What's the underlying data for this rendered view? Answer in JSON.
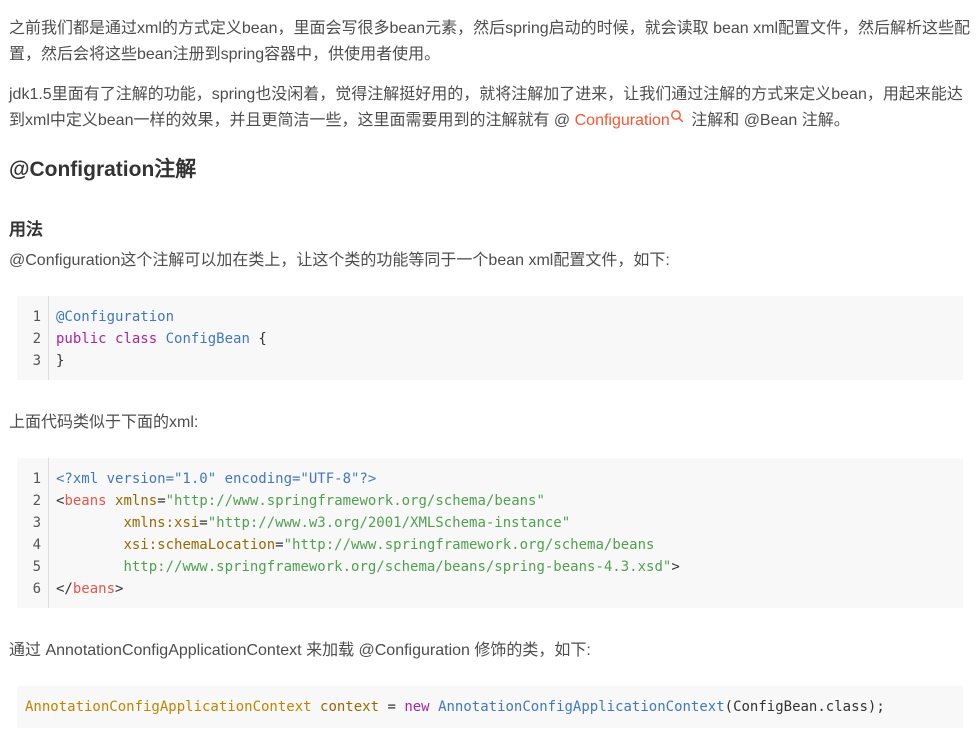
{
  "intro": {
    "p1": "之前我们都是通过xml的方式定义bean，里面会写很多bean元素，然后spring启动的时候，就会读取 bean xml配置文件，然后解析这些配置，然后会将这些bean注册到spring容器中，供使用者使用。",
    "p2_before": "jdk1.5里面有了注解的功能，spring也没闲着，觉得注解挺好用的，就将注解加了进来，让我们通过注解的方式来定义bean，用起来能达到xml中定义bean一样的效果，并且更简洁一些，这里面需要用到的注解就有 @ ",
    "p2_link": "Configuration",
    "p2_after": " 注解和 @Bean 注解。"
  },
  "section": {
    "title": "@Configration注解",
    "subtitle": "用法",
    "desc": "@Configuration这个注解可以加在类上，让这个类的功能等同于一个bean xml配置文件，如下:",
    "xml_intro": "上面代码类似于下面的xml:",
    "ctx_intro": "通过 AnnotationConfigApplicationContext 来加载 @Configuration 修饰的类，如下:"
  },
  "code1": {
    "line_numbers": [
      "1",
      "2",
      "3"
    ],
    "l1_annotation": "@Configuration",
    "l2_public": "public",
    "l2_class_kw": "class",
    "l2_name": "ConfigBean",
    "l2_brace": " {",
    "l3": "}"
  },
  "code2": {
    "line_numbers": [
      "1",
      "2",
      "3",
      "4",
      "5",
      "6"
    ],
    "l1": "<?xml version=\"1.0\" encoding=\"UTF-8\"?>",
    "l2_open": "<",
    "l2_tag": "beans",
    "l2_attr": "xmlns",
    "l2_val": "\"http://www.springframework.org/schema/beans\"",
    "l3_attr": "xmlns:xsi",
    "l3_val": "\"http://www.w3.org/2001/XMLSchema-instance\"",
    "l4_attr": "xsi:schemaLocation",
    "l4_val": "\"http://www.springframework.org/schema/beans",
    "l5_val": "http://www.springframework.org/schema/beans/spring-beans-4.3.xsd\"",
    "l5_end": ">",
    "l6_open": "</",
    "l6_tag": "beans",
    "l6_end": ">",
    "eq": "=",
    "indent": "        "
  },
  "code3": {
    "type": "AnnotationConfigApplicationContext",
    "var": "context",
    "eq": " = ",
    "new_kw": "new",
    "ctor": "AnnotationConfigApplicationContext",
    "args": "(ConfigBean.class);"
  },
  "colors": {
    "link": "#fc5531",
    "code_bg": "#f8f8f8",
    "keyword": "#a626a4",
    "tag": "#e45649",
    "string": "#50a14f",
    "meta": "#4078c0"
  }
}
